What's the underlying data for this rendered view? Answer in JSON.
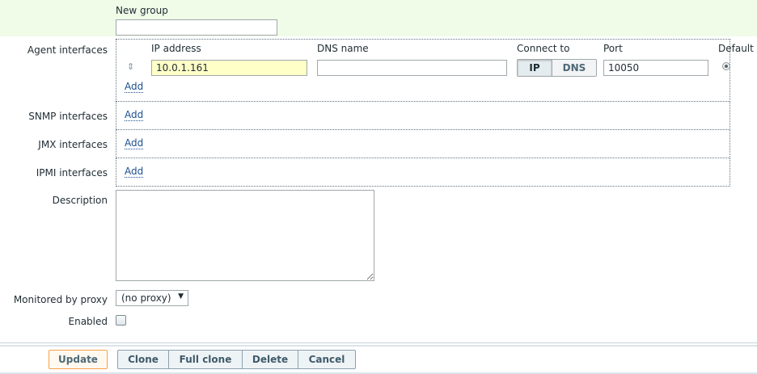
{
  "new_group": {
    "label": "New group",
    "value": ""
  },
  "rows": {
    "agent_label": "Agent interfaces",
    "snmp_label": "SNMP interfaces",
    "jmx_label": "JMX interfaces",
    "ipmi_label": "IPMI interfaces",
    "description_label": "Description",
    "proxy_label": "Monitored by proxy",
    "enabled_label": "Enabled"
  },
  "agent": {
    "headers": {
      "ip": "IP address",
      "dns": "DNS name",
      "connect": "Connect to",
      "port": "Port",
      "default": "Default"
    },
    "ip_value": "10.0.1.161",
    "dns_value": "",
    "connect_ip": "IP",
    "connect_dns": "DNS",
    "connect_selected": "IP",
    "port_value": "10050",
    "default_selected": true,
    "drag_icon": "⇕"
  },
  "add_label": "Add",
  "proxy": {
    "selected": "(no proxy)"
  },
  "enabled": false,
  "buttons": {
    "update": "Update",
    "clone": "Clone",
    "full_clone": "Full clone",
    "delete": "Delete",
    "cancel": "Cancel"
  },
  "colors": {
    "accent": "#f5a14a",
    "link": "#1c4f8f",
    "highlight_input": "#ffffc8",
    "band": "#f0fbe8"
  }
}
